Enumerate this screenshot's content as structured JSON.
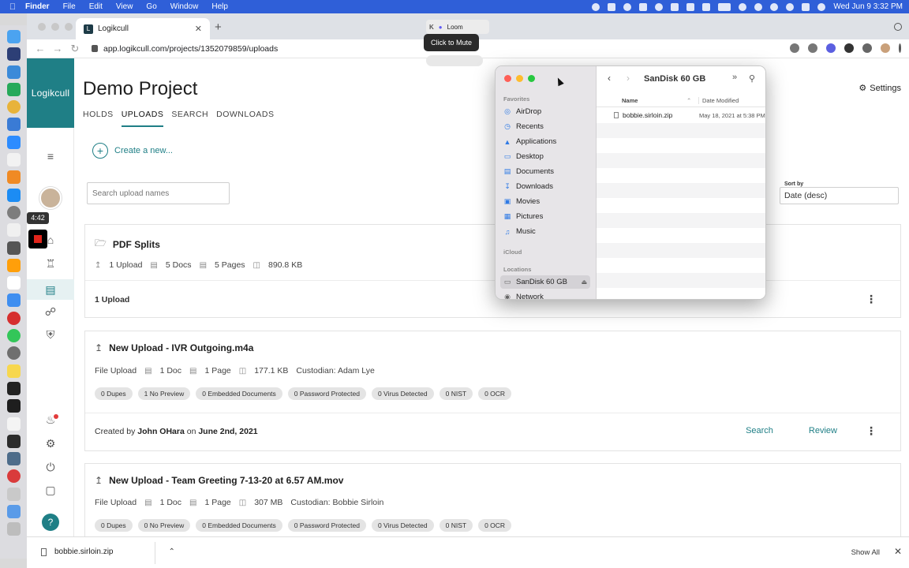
{
  "menubar": {
    "app": "Finder",
    "items": [
      "File",
      "Edit",
      "View",
      "Go",
      "Window",
      "Help"
    ],
    "clock": "Wed Jun 9  3:32 PM"
  },
  "recording": {
    "timer": "4:42"
  },
  "browser": {
    "tab_title": "Logikcull",
    "url": "app.logikcull.com/projects/1352079859/uploads",
    "loom": {
      "ext_label": "Loom",
      "tooltip": "Click to Mute"
    }
  },
  "app": {
    "logo": "Logikcull",
    "project_title": "Demo Project",
    "settings_label": "Settings",
    "tabs": [
      "HOLDS",
      "UPLOADS",
      "SEARCH",
      "DOWNLOADS"
    ],
    "active_tab": "UPLOADS",
    "create_label": "Create a new...",
    "search_placeholder": "Search upload names",
    "sort": {
      "label": "Sort by",
      "value": "Date (desc)"
    },
    "cards": [
      {
        "title": "PDF Splits",
        "stats": [
          "1 Upload",
          "5 Docs",
          "5 Pages",
          "890.8 KB"
        ],
        "footer": "1 Upload"
      },
      {
        "title": "New Upload - IVR Outgoing.m4a",
        "stats": [
          "File Upload",
          "1 Doc",
          "1 Page",
          "177.1 KB",
          "Custodian: Adam Lye"
        ],
        "pills": [
          "0 Dupes",
          "1 No Preview",
          "0 Embedded Documents",
          "0 Password Protected",
          "0 Virus Detected",
          "0 NIST",
          "0 OCR"
        ],
        "created_prefix": "Created by",
        "created_by": "John OHara",
        "created_on_prefix": "on",
        "created_on": "June 2nd, 2021",
        "search_label": "Search",
        "review_label": "Review"
      },
      {
        "title": "New Upload - Team Greeting 7-13-20 at 6.57 AM.mov",
        "stats": [
          "File Upload",
          "1 Doc",
          "1 Page",
          "307 MB",
          "Custodian: Bobbie Sirloin"
        ],
        "pills": [
          "0 Dupes",
          "0 No Preview",
          "0 Embedded Documents",
          "0 Password Protected",
          "0 Virus Detected",
          "0 NIST",
          "0 OCR"
        ]
      }
    ]
  },
  "downloads": {
    "file": "bobbie.sirloin.zip",
    "show_all": "Show All"
  },
  "finder": {
    "title": "SanDisk 60 GB",
    "sections": {
      "favorites": "Favorites",
      "icloud": "iCloud",
      "locations": "Locations"
    },
    "favorites": [
      "AirDrop",
      "Recents",
      "Applications",
      "Desktop",
      "Documents",
      "Downloads",
      "Movies",
      "Pictures",
      "Music"
    ],
    "locations": [
      "SanDisk 60 GB",
      "Network"
    ],
    "columns": {
      "name": "Name",
      "date": "Date Modified"
    },
    "files": [
      {
        "name": "bobbie.sirloin.zip",
        "date": "May 18, 2021 at 5:38 PM"
      }
    ]
  },
  "colors": {
    "accent": "#1f7f86",
    "menubar": "#2f5fd8",
    "close": "#ff5f57",
    "minimize": "#febc2e",
    "zoom": "#28c840"
  }
}
